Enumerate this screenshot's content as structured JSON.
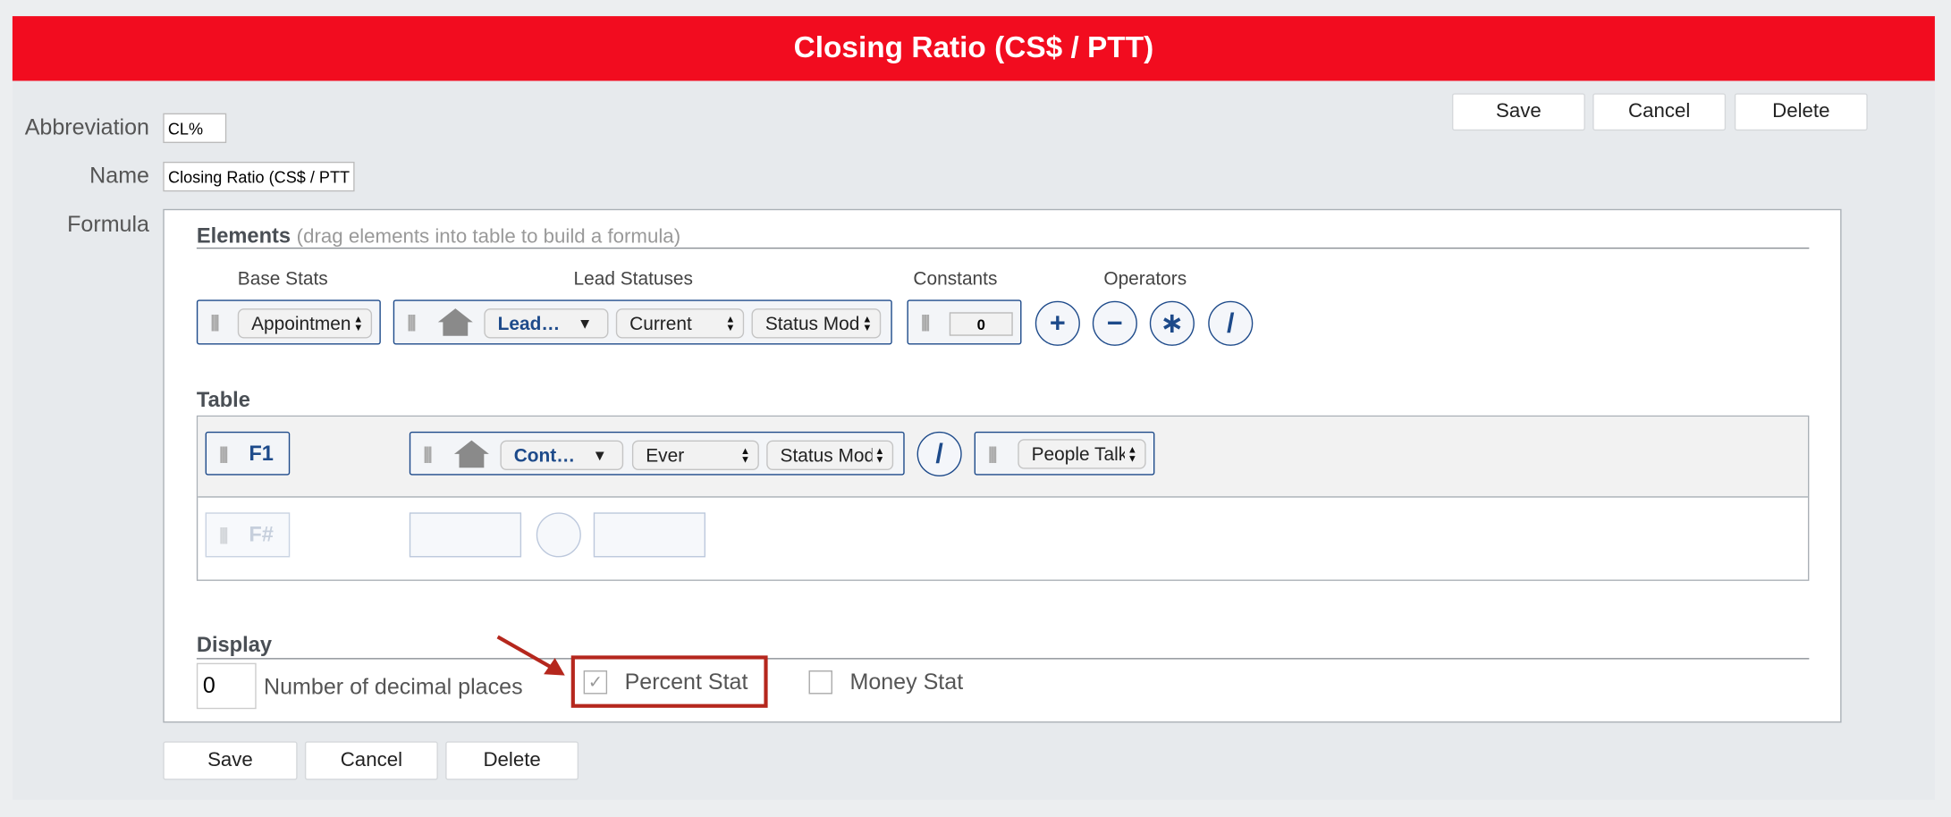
{
  "title": "Closing Ratio (CS$ / PTT)",
  "actions": {
    "save": "Save",
    "cancel": "Cancel",
    "delete": "Delete"
  },
  "form": {
    "abbreviation_label": "Abbreviation",
    "abbreviation_value": "CL%",
    "name_label": "Name",
    "name_value": "Closing Ratio (CS$ / PTT)",
    "formula_label": "Formula"
  },
  "elements": {
    "heading": "Elements",
    "hint": "(drag elements into table to build a formula)",
    "base_stats_label": "Base Stats",
    "base_stats_value": "Appointments",
    "lead_statuses_label": "Lead Statuses",
    "lead_value": "Lead…",
    "lead_period": "Current",
    "lead_mode": "Status Mode",
    "constants_label": "Constants",
    "constant_value": "0",
    "operators_label": "Operators",
    "operators": [
      "+",
      "−",
      "∗",
      "/"
    ]
  },
  "table": {
    "heading": "Table",
    "row1": {
      "id": "F1",
      "lead_value": "Cont…",
      "period": "Ever",
      "mode": "Status Mode",
      "operator": "/",
      "stat": "People Talked To"
    },
    "row2": {
      "id": "F#"
    }
  },
  "display": {
    "heading": "Display",
    "decimals_value": "0",
    "decimals_label": "Number of decimal places",
    "percent_label": "Percent Stat",
    "percent_checked": true,
    "money_label": "Money Stat",
    "money_checked": false
  },
  "colors": {
    "accent": "#f20c1f",
    "chip_border": "#1d4a8a",
    "annotation": "#b5271d"
  },
  "icons": [
    "grip-icon",
    "house-icon",
    "dropdown-arrow-icon",
    "updown-arrows-icon",
    "check-icon",
    "annotation-arrow-icon"
  ]
}
